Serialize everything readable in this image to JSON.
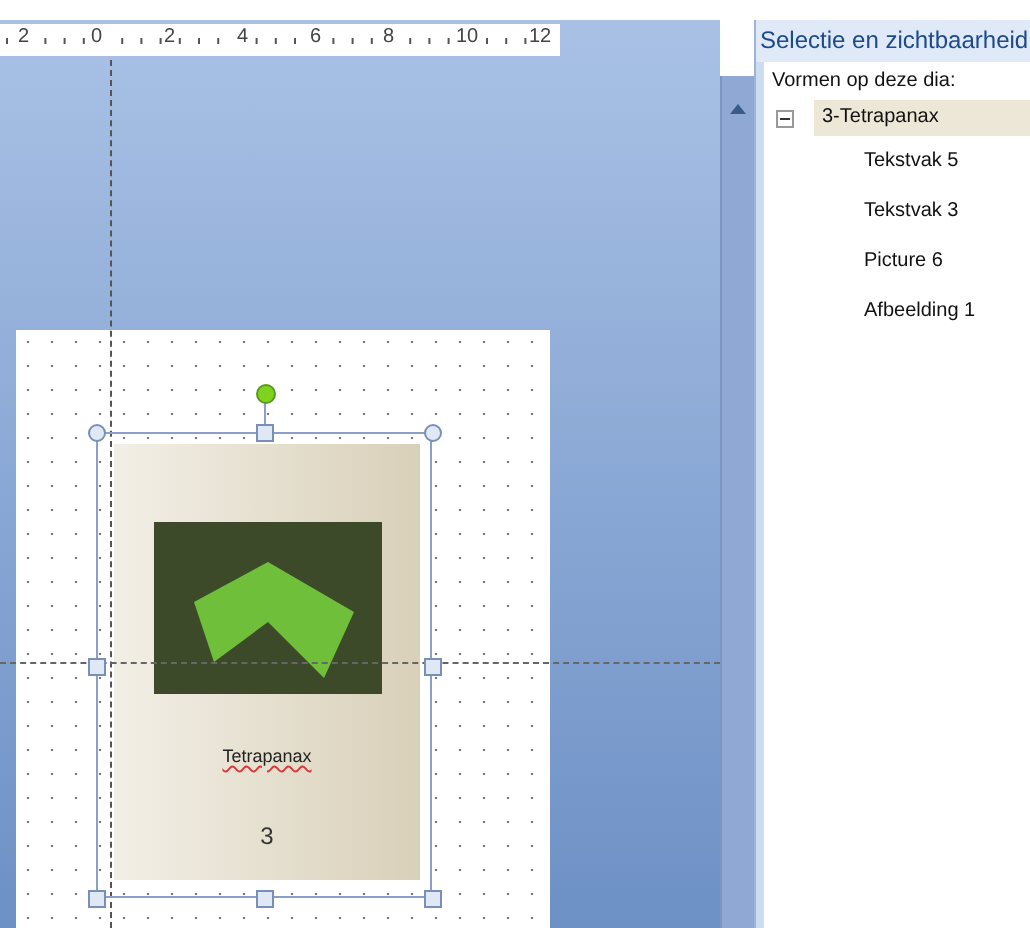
{
  "ruler": {
    "labels": [
      "2",
      "0",
      "2",
      "4",
      "6",
      "8",
      "10",
      "12"
    ]
  },
  "slide": {
    "caption": "Tetrapanax",
    "page_number": "3"
  },
  "selection_pane": {
    "title": "Selectie en zichtbaarheid",
    "subtitle": "Vormen op deze dia:",
    "tree": [
      {
        "label": "3-Tetrapanax",
        "selected": true,
        "expanded": true,
        "children": [
          {
            "label": "Tekstvak 5",
            "selected": false
          },
          {
            "label": "Tekstvak 3",
            "selected": false
          },
          {
            "label": "Picture 6",
            "selected": false
          },
          {
            "label": "Afbeelding 1",
            "selected": false
          }
        ]
      }
    ]
  }
}
